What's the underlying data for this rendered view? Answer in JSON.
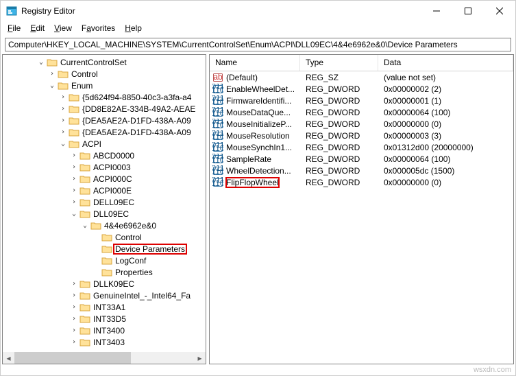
{
  "window": {
    "title": "Registry Editor"
  },
  "menu": {
    "file": "File",
    "edit": "Edit",
    "view": "View",
    "favorites": "Favorites",
    "help": "Help"
  },
  "address": "Computer\\HKEY_LOCAL_MACHINE\\SYSTEM\\CurrentControlSet\\Enum\\ACPI\\DLL09EC\\4&4e6962e&0\\Device Parameters",
  "tree": [
    {
      "label": "CurrentControlSet",
      "depth": 3,
      "exp": "open"
    },
    {
      "label": "Control",
      "depth": 4,
      "exp": "closed"
    },
    {
      "label": "Enum",
      "depth": 4,
      "exp": "open"
    },
    {
      "label": "{5d624f94-8850-40c3-a3fa-a4",
      "depth": 5,
      "exp": "closed"
    },
    {
      "label": "{DD8E82AE-334B-49A2-AEAE",
      "depth": 5,
      "exp": "closed"
    },
    {
      "label": "{DEA5AE2A-D1FD-438A-A09",
      "depth": 5,
      "exp": "closed"
    },
    {
      "label": "{DEA5AE2A-D1FD-438A-A09",
      "depth": 5,
      "exp": "closed"
    },
    {
      "label": "ACPI",
      "depth": 5,
      "exp": "open"
    },
    {
      "label": "ABCD0000",
      "depth": 6,
      "exp": "closed"
    },
    {
      "label": "ACPI0003",
      "depth": 6,
      "exp": "closed"
    },
    {
      "label": "ACPI000C",
      "depth": 6,
      "exp": "closed"
    },
    {
      "label": "ACPI000E",
      "depth": 6,
      "exp": "closed"
    },
    {
      "label": "DELL09EC",
      "depth": 6,
      "exp": "closed"
    },
    {
      "label": "DLL09EC",
      "depth": 6,
      "exp": "open"
    },
    {
      "label": "4&4e6962e&0",
      "depth": 7,
      "exp": "open"
    },
    {
      "label": "Control",
      "depth": 8,
      "exp": "none"
    },
    {
      "label": "Device Parameters",
      "depth": 8,
      "exp": "none",
      "selected": true
    },
    {
      "label": "LogConf",
      "depth": 8,
      "exp": "none"
    },
    {
      "label": "Properties",
      "depth": 8,
      "exp": "none"
    },
    {
      "label": "DLLK09EC",
      "depth": 6,
      "exp": "closed"
    },
    {
      "label": "GenuineIntel_-_Intel64_Fa",
      "depth": 6,
      "exp": "closed"
    },
    {
      "label": "INT33A1",
      "depth": 6,
      "exp": "closed"
    },
    {
      "label": "INT33D5",
      "depth": 6,
      "exp": "closed"
    },
    {
      "label": "INT3400",
      "depth": 6,
      "exp": "closed"
    },
    {
      "label": "INT3403",
      "depth": 6,
      "exp": "closed"
    }
  ],
  "columns": {
    "name": "Name",
    "type": "Type",
    "data": "Data"
  },
  "values": [
    {
      "icon": "string",
      "name": "(Default)",
      "type": "REG_SZ",
      "data": "(value not set)"
    },
    {
      "icon": "binary",
      "name": "EnableWheelDet...",
      "type": "REG_DWORD",
      "data": "0x00000002 (2)"
    },
    {
      "icon": "binary",
      "name": "FirmwareIdentifi...",
      "type": "REG_DWORD",
      "data": "0x00000001 (1)"
    },
    {
      "icon": "binary",
      "name": "MouseDataQue...",
      "type": "REG_DWORD",
      "data": "0x00000064 (100)"
    },
    {
      "icon": "binary",
      "name": "MouseInitializeP...",
      "type": "REG_DWORD",
      "data": "0x00000000 (0)"
    },
    {
      "icon": "binary",
      "name": "MouseResolution",
      "type": "REG_DWORD",
      "data": "0x00000003 (3)"
    },
    {
      "icon": "binary",
      "name": "MouseSynchIn1...",
      "type": "REG_DWORD",
      "data": "0x01312d00 (20000000)"
    },
    {
      "icon": "binary",
      "name": "SampleRate",
      "type": "REG_DWORD",
      "data": "0x00000064 (100)"
    },
    {
      "icon": "binary",
      "name": "WheelDetection...",
      "type": "REG_DWORD",
      "data": "0x000005dc (1500)"
    },
    {
      "icon": "binary",
      "name": "FlipFlopWheel",
      "type": "REG_DWORD",
      "data": "0x00000000 (0)",
      "highlight": true
    }
  ],
  "watermark": "wsxdn.com"
}
